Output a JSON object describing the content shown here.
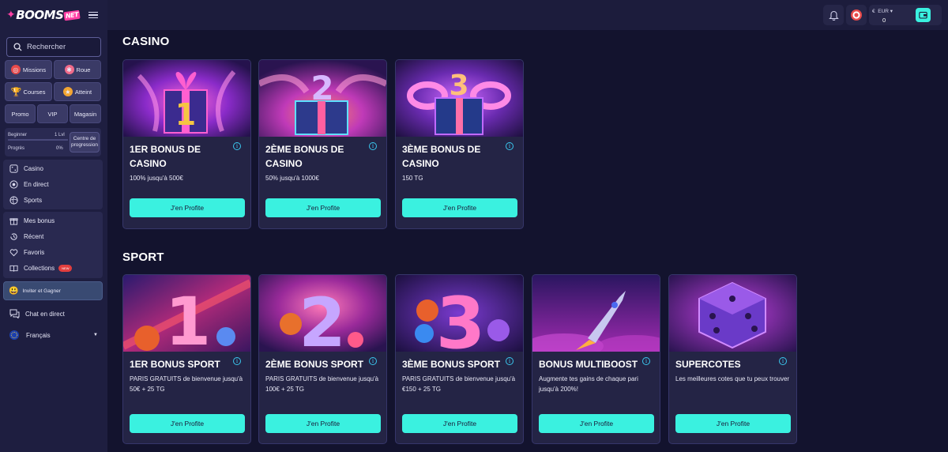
{
  "brand": {
    "name": "BOOMS",
    "suffix": "NET"
  },
  "search": {
    "placeholder": "Rechercher"
  },
  "quick": {
    "missions": "Missions",
    "roue": "Roue",
    "courses": "Courses",
    "atteint": "Atteint",
    "promo": "Promo",
    "vip": "VIP",
    "magasin": "Magasin"
  },
  "level": {
    "name": "Beginner",
    "lvl": "1 Lvl",
    "progress_label": "Progrès",
    "progress_value": "0%",
    "center_button": "Centre de progression"
  },
  "nav_main": [
    "Casino",
    "En direct",
    "Sports"
  ],
  "nav_personal": {
    "bonus": "Mes bonus",
    "recent": "Récent",
    "favoris": "Favoris",
    "collections": "Collections",
    "collections_badge": "NEW"
  },
  "invite": "Inviter et Gagner",
  "chat": "Chat en direct",
  "language": "Français",
  "wallet": {
    "currency": "EUR",
    "amount": "0"
  },
  "sections": {
    "casino_title": "CASINO",
    "sport_title": "SPORT"
  },
  "casino_cards": [
    {
      "title": "1ER BONUS DE CASINO",
      "desc": "100% jusqu'à 500€",
      "button": "J'en Profite"
    },
    {
      "title": "2ÈME BONUS DE CASINO",
      "desc": "50% jusqu'à 1000€",
      "button": "J'en Profite"
    },
    {
      "title": "3ÈME BONUS DE CASINO",
      "desc": "150 TG",
      "button": "J'en Profite"
    }
  ],
  "sport_cards": [
    {
      "title": "1ER BONUS SPORT",
      "desc": "PARIS GRATUITS de bienvenue jusqu'à 50€ + 25 TG",
      "button": "J'en Profite"
    },
    {
      "title": "2ÈME BONUS SPORT",
      "desc": "PARIS GRATUITS de bienvenue jusqu'à 100€ + 25 TG",
      "button": "J'en Profite"
    },
    {
      "title": "3ÈME BONUS SPORT",
      "desc": "PARIS GRATUITS de bienvenue jusqu'à €150 + 25 TG",
      "button": "J'en Profite"
    },
    {
      "title": "BONUS MULTIBOOST",
      "desc": "Augmente tes gains de chaque pari jusqu'à 200%!",
      "button": "J'en Profite"
    },
    {
      "title": "SUPERCOTES",
      "desc": "Les meilleures cotes que tu peux trouver",
      "button": "J'en Profite"
    }
  ],
  "colors": {
    "accent": "#3af1e0",
    "background": "#13132e",
    "sidebar": "#1e1e40",
    "card": "#242445",
    "brand_pink": "#ff3fa4",
    "info": "#3ac7ee"
  }
}
